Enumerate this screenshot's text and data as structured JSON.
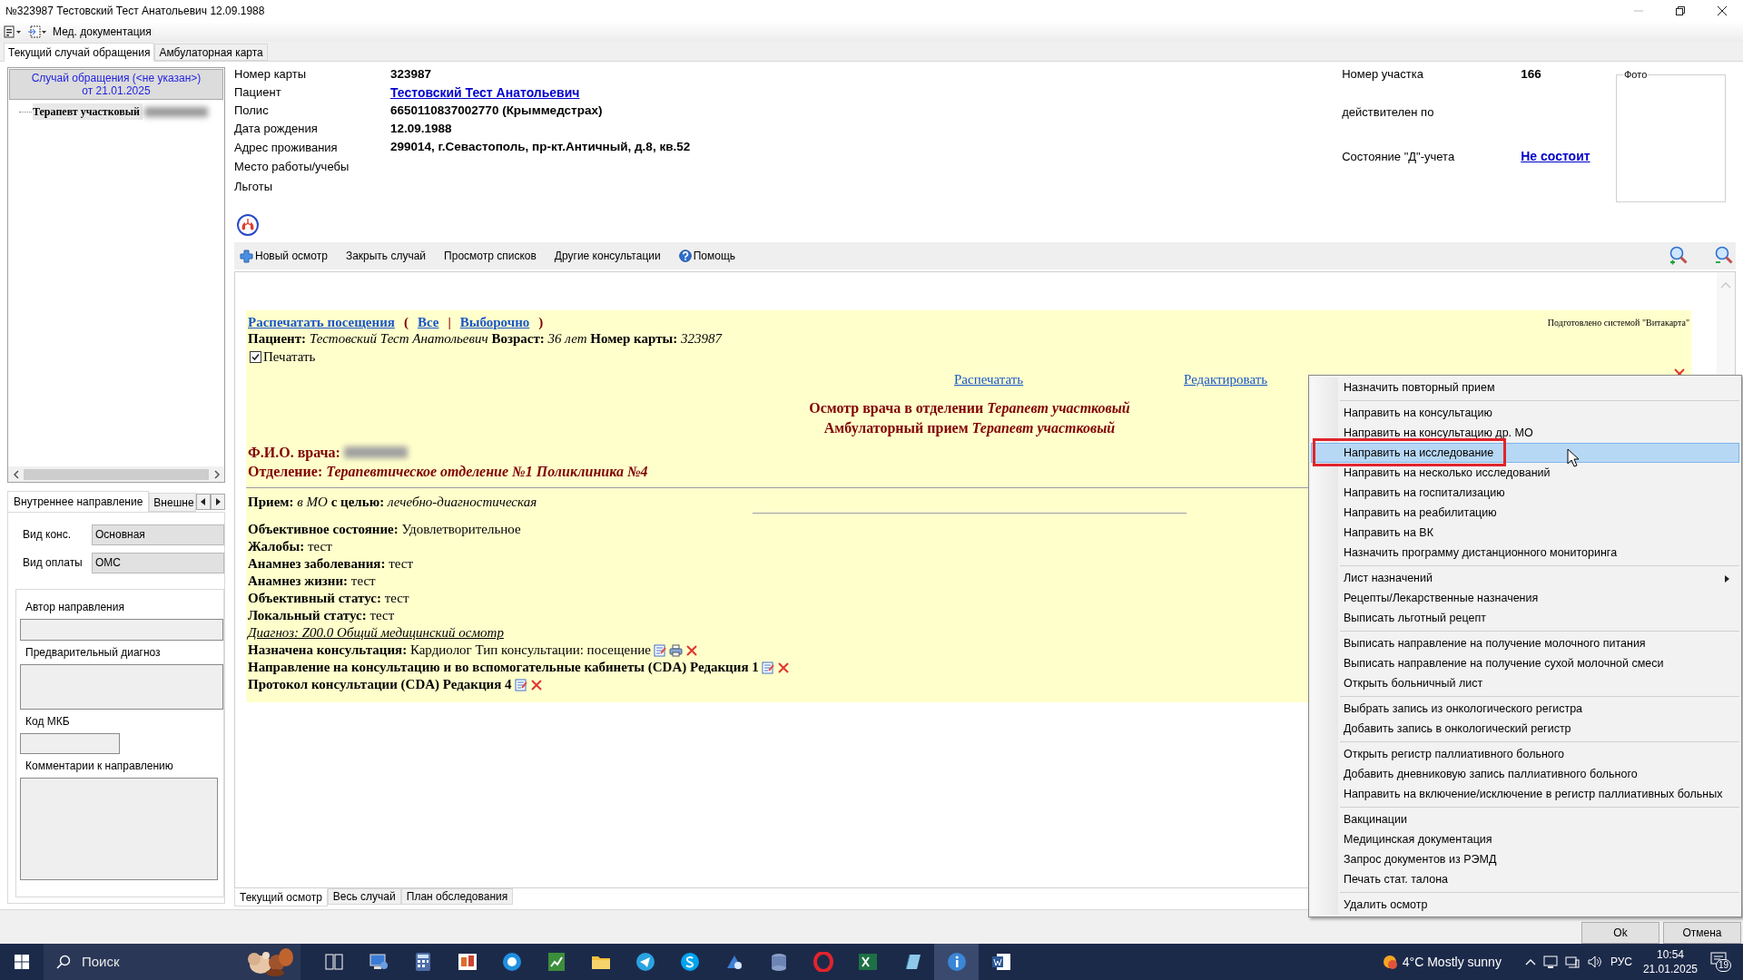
{
  "window": {
    "title": "№323987 Тестовский Тест Анатольевич 12.09.1988"
  },
  "toolbar": {
    "menu": "Мед. документация"
  },
  "tabs": [
    {
      "label": "Текущий случай обращения",
      "selected": true
    },
    {
      "label": "Амбулаторная карта",
      "selected": false
    }
  ],
  "case_panel": {
    "header": [
      "Случай обращения (<не указан>)",
      "от 21.01.2025"
    ],
    "tree": [
      {
        "label": "Терапевт участковый",
        "redacted": true
      }
    ]
  },
  "referral": {
    "tabs": [
      {
        "label": "Внутреннее направление",
        "selected": true
      },
      {
        "label": "Внешне",
        "selected": false
      }
    ],
    "fields": [
      {
        "label": "Вид конс.",
        "value": "Основная"
      },
      {
        "label": "Вид оплаты",
        "value": "ОМС"
      }
    ],
    "group": [
      {
        "label": "Автор направления",
        "kind": "line"
      },
      {
        "label": "Предварительный диагноз",
        "kind": "area"
      },
      {
        "label": "Код МКБ",
        "kind": "short"
      },
      {
        "label": "Комментарии к направлению",
        "kind": "big"
      }
    ]
  },
  "patient": {
    "rows": [
      {
        "label": "Номер карты",
        "value": "323987",
        "kind": "text"
      },
      {
        "label": "Пациент",
        "value": "Тестовский Тест Анатольевич",
        "kind": "link"
      },
      {
        "label": "Полис",
        "value": "6650110837002770 (Крыммедстрах)",
        "kind": "text"
      },
      {
        "label": "Дата рождения",
        "value": "12.09.1988",
        "kind": "text"
      },
      {
        "label": "Адрес проживания",
        "value": "299014, г.Севастополь, пр-кт.Античный, д.8, кв.52",
        "kind": "text"
      },
      {
        "label": "Место работы/учебы"
      },
      {
        "label": "Льготы"
      }
    ],
    "side": [
      {
        "label": "Номер участка",
        "value": "166",
        "kind": "text"
      },
      {
        "label": "действителен по"
      },
      {
        "label": "Состояние \"Д\"-учета",
        "value": "Не состоит",
        "kind": "link"
      }
    ],
    "photo": "Фото"
  },
  "actions": [
    {
      "label": "Новый осмотр",
      "kind": "plus"
    },
    {
      "label": "Закрыть случай",
      "kind": "plain"
    },
    {
      "label": "Просмотр списков",
      "kind": "plain"
    },
    {
      "label": "Другие консультации",
      "kind": "plain"
    },
    {
      "label": "Помощь",
      "kind": "help"
    }
  ],
  "report": {
    "header": [
      {
        "kind": "link",
        "text": "Распечатать посещения"
      },
      {
        "kind": "punct",
        "text": "("
      },
      {
        "kind": "link",
        "text": "Все"
      },
      {
        "kind": "punct",
        "text": "|"
      },
      {
        "kind": "link",
        "text": "Выборочно"
      },
      {
        "kind": "punct",
        "text": ")"
      }
    ],
    "credit": "Подготовлено системой \"Витакарта\"",
    "patient_line": "**Пациент:** *Тестовский Тест Анатольевич* **Возраст:** *36 лет* **Номер карты:** *323987*",
    "print_checkbox": {
      "label": "Печатать",
      "checked": true
    },
    "links": [
      "Распечатать",
      "Редактировать"
    ],
    "titles": [
      "Осмотр врача в отделении *Терапевт участковый*",
      "Амбулаторный прием *Терапевт участковый*"
    ],
    "doctor": {
      "label": "Ф.И.О. врача:",
      "redacted": true
    },
    "department": "Отделение: *Терапевтическое отделение №1 Поликлиника №4*",
    "visit": "**Прием:** *в МО* **с целью:** *лечебно-диагностическая*",
    "lines": [
      {
        "kind": "plain",
        "text": "**Объективное состояние:** Удовлетворительное"
      },
      {
        "kind": "plain",
        "text": "**Жалобы:** тест"
      },
      {
        "kind": "plain",
        "text": "**Анамнез заболевания:** тест"
      },
      {
        "kind": "plain",
        "text": "**Анамнез жизни:** тест"
      },
      {
        "kind": "plain",
        "text": "**Объективный статус:** тест"
      },
      {
        "kind": "plain",
        "text": "**Локальный статус:** тест"
      },
      {
        "kind": "diagnosis",
        "text": "Диагноз: Z00.0 Общий медицинский осмотр"
      },
      {
        "kind": "plain",
        "text": "**Назначена консультация:** Кардиолог Тип консультации: посещение",
        "actions": [
          {
            "kind": "edit"
          },
          {
            "kind": "print"
          },
          {
            "kind": "delete"
          }
        ]
      },
      {
        "kind": "bold",
        "text": "Направление на консультацию и во вспомогательные кабинеты (CDA) Редакция 1",
        "actions": [
          {
            "kind": "edit"
          },
          {
            "kind": "delete"
          }
        ]
      },
      {
        "kind": "bold",
        "text": "Протокол консультации (CDA) Редакция 4",
        "actions": [
          {
            "kind": "edit"
          },
          {
            "kind": "delete"
          }
        ]
      }
    ]
  },
  "bottom_tabs": [
    {
      "label": "Текущий осмотр",
      "selected": true
    },
    {
      "label": "Весь случай",
      "selected": false
    },
    {
      "label": "План обследования",
      "selected": false
    }
  ],
  "buttons": [
    "Ok",
    "Отмена"
  ],
  "context_menu": {
    "groups": [
      [
        {
          "label": "Назначить повторный прием",
          "selected": false,
          "submenu": false
        }
      ],
      [
        {
          "label": "Направить на консультацию",
          "selected": false,
          "submenu": false
        },
        {
          "label": "Направить на консультацию др. МО",
          "selected": false,
          "submenu": false
        },
        {
          "label": "Направить на исследование",
          "selected": true,
          "submenu": false
        },
        {
          "label": "Направить на несколько исследований",
          "selected": false,
          "submenu": false
        },
        {
          "label": "Направить на госпитализацию",
          "selected": false,
          "submenu": false
        },
        {
          "label": "Направить на реабилитацию",
          "selected": false,
          "submenu": false
        },
        {
          "label": "Направить на ВК",
          "selected": false,
          "submenu": false
        },
        {
          "label": "Назначить программу дистанционного мониторинга",
          "selected": false,
          "submenu": false
        }
      ],
      [
        {
          "label": "Лист назначений",
          "selected": false,
          "submenu": true
        },
        {
          "label": "Рецепты/Лекарственные назначения",
          "selected": false,
          "submenu": false
        },
        {
          "label": "Выписать льготный рецепт",
          "selected": false,
          "submenu": false
        }
      ],
      [
        {
          "label": "Выписать направление на получение молочного питания",
          "selected": false,
          "submenu": false
        },
        {
          "label": "Выписать направление на получение сухой молочной смеси",
          "selected": false,
          "submenu": false
        },
        {
          "label": "Открыть больничный лист",
          "selected": false,
          "submenu": false
        }
      ],
      [
        {
          "label": "Выбрать запись из онкологического регистра",
          "selected": false,
          "submenu": false
        },
        {
          "label": "Добавить запись в онкологический регистр",
          "selected": false,
          "submenu": false
        }
      ],
      [
        {
          "label": "Открыть регистр паллиативного больного",
          "selected": false,
          "submenu": false
        },
        {
          "label": "Добавить дневниковую запись паллиативного больного",
          "selected": false,
          "submenu": false
        },
        {
          "label": "Направить на включение/исключение в регистр паллиативных больных",
          "selected": false,
          "submenu": false
        }
      ],
      [
        {
          "label": "Вакцинации",
          "selected": false,
          "submenu": false
        },
        {
          "label": "Медицинская документация",
          "selected": false,
          "submenu": false
        },
        {
          "label": "Запрос документов из РЭМД",
          "selected": false,
          "submenu": false
        },
        {
          "label": "Печать стат. талона",
          "selected": false,
          "submenu": false
        }
      ],
      [
        {
          "label": "Удалить осмотр",
          "selected": false,
          "submenu": false
        }
      ]
    ]
  },
  "taskbar": {
    "search_placeholder": "Поиск",
    "weather": "4°C Mostly sunny",
    "language": "РУС",
    "time": "10:54",
    "date": "21.01.2025",
    "notifications": "19"
  }
}
